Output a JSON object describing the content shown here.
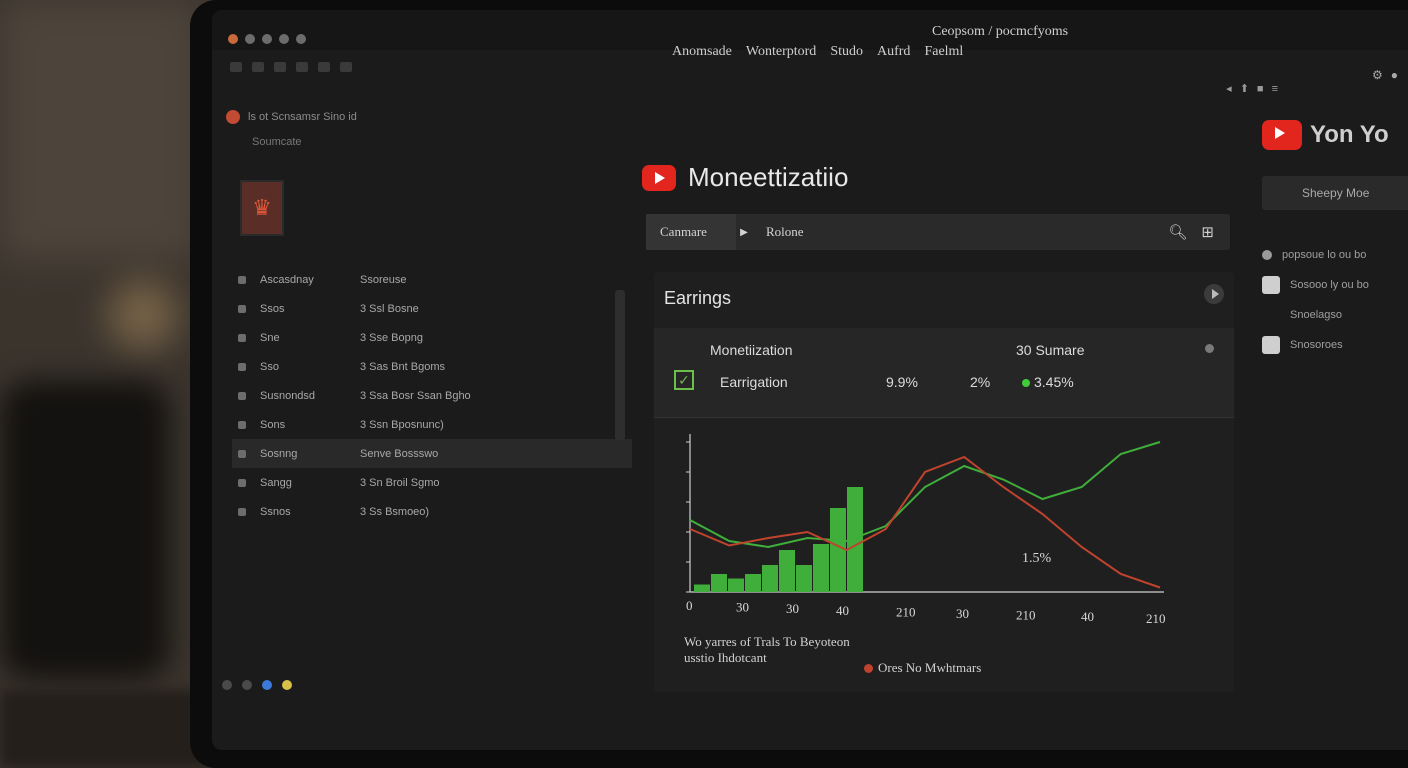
{
  "menu": {
    "items": [
      "Anomsade",
      "Wonterptord",
      "Studo",
      "Aufrd",
      "Faelml"
    ],
    "right": "Ceopsom / pocmcfyoms"
  },
  "left_panel": {
    "breadcrumb": "ls ot Scnsamsr Sino id",
    "subtitle": "Soumcate",
    "nav": [
      {
        "key": "Ascasdnay",
        "val": "Ssoreuse"
      },
      {
        "key": "Ssos",
        "val": "3 Ssl Bosne"
      },
      {
        "key": "Sne",
        "val": "3 Sse Bopng"
      },
      {
        "key": "Sso",
        "val": "3 Sas Bnt Bgoms"
      },
      {
        "key": "Susnondsd",
        "val": "3 Ssa Bosr Ssan Bgho"
      },
      {
        "key": "Sons",
        "val": "3 Ssn Bposnunc)"
      },
      {
        "key": "Sosnng",
        "val": "Senve Bossswo"
      },
      {
        "key": "Sangg",
        "val": "3 Sn Broil Sgmo"
      },
      {
        "key": "Ssnos",
        "val": "3 Ss Bsmoeo)"
      }
    ]
  },
  "main": {
    "title": "Moneettizatiio",
    "search": {
      "segment1": "Canmare",
      "segment2": "Rolone"
    },
    "earnings": {
      "heading": "Earrings",
      "table": {
        "header_left": "Monetiization",
        "header_right": "30 Sumare",
        "row_label": "Earrigation",
        "val1": "9.9%",
        "val2": "2%",
        "val3": "3.45%"
      },
      "annotation": "1.5%",
      "legend1_line1": "Wo yarres of Trals To Beyoteon",
      "legend1_line2": "usstio Ihdotcant",
      "legend2": "Ores No Mwhtmars"
    }
  },
  "right_panel": {
    "brand": "Yon Yo",
    "button": "Sheepy Moe",
    "items": [
      "popsoue lo ou bo",
      "Sosooo ly ou bo",
      "Snoelagso",
      "Snosoroes"
    ]
  },
  "chart_data": {
    "type": "bar",
    "x_tick_labels": [
      "0",
      "30",
      "30",
      "40",
      "210",
      "30",
      "210",
      "40",
      "210"
    ],
    "bars": [
      5,
      12,
      9,
      12,
      18,
      28,
      18,
      32,
      56,
      70
    ],
    "series": [
      {
        "color": "#3fae3a",
        "values": [
          48,
          34,
          30,
          36,
          34,
          44,
          70,
          84,
          75,
          62,
          70,
          92,
          100
        ]
      },
      {
        "color": "#c0432d",
        "values": [
          42,
          31,
          36,
          40,
          28,
          42,
          80,
          90,
          70,
          52,
          30,
          12,
          3
        ]
      }
    ],
    "colors": {
      "bar": "#3fae3a",
      "line_green": "#3fae3a",
      "line_red": "#c0432d"
    }
  }
}
